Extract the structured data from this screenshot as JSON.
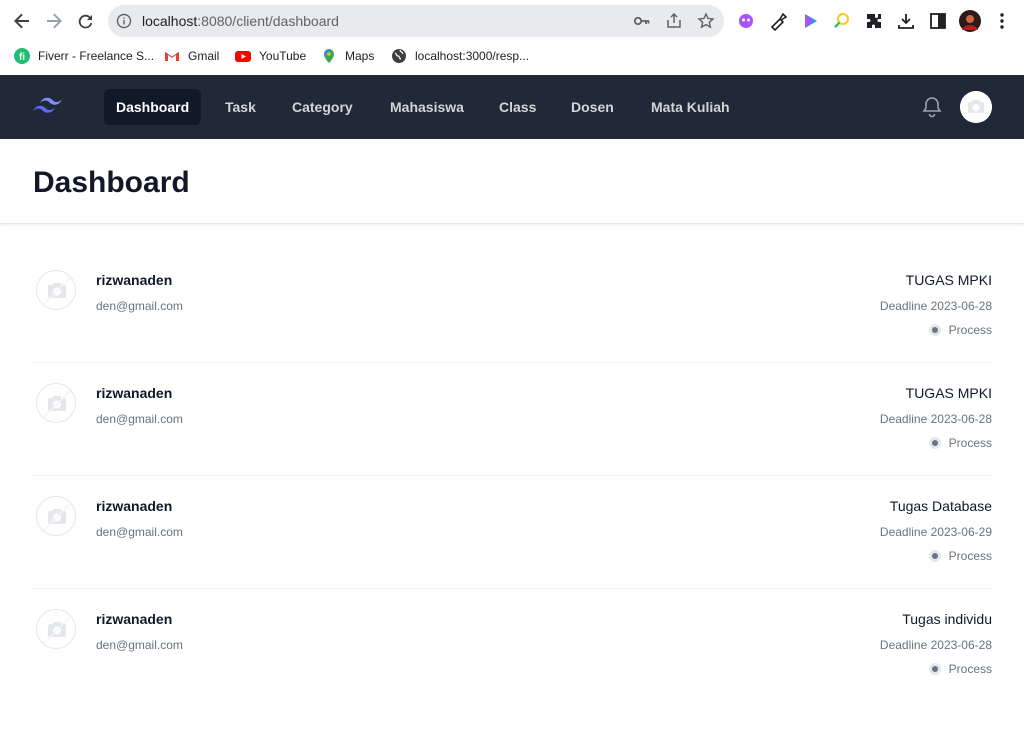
{
  "browser": {
    "url_host": "localhost",
    "url_path": ":8080/client/dashboard",
    "bookmarks": [
      {
        "label": "Fiverr - Freelance S...",
        "icon": "fiverr-icon"
      },
      {
        "label": "Gmail",
        "icon": "gmail-icon"
      },
      {
        "label": "YouTube",
        "icon": "youtube-icon"
      },
      {
        "label": "Maps",
        "icon": "maps-icon"
      },
      {
        "label": "localhost:3000/resp...",
        "icon": "globe-icon"
      }
    ]
  },
  "nav": {
    "items": [
      {
        "label": "Dashboard",
        "active": true
      },
      {
        "label": "Task"
      },
      {
        "label": "Category"
      },
      {
        "label": "Mahasiswa"
      },
      {
        "label": "Class"
      },
      {
        "label": "Dosen"
      },
      {
        "label": "Mata Kuliah"
      }
    ]
  },
  "header": {
    "title": "Dashboard"
  },
  "tasks": [
    {
      "name": "rizwanaden",
      "email": "den@gmail.com",
      "task": "TUGAS MPKI",
      "deadline": "Deadline 2023-06-28",
      "status": "Process"
    },
    {
      "name": "rizwanaden",
      "email": "den@gmail.com",
      "task": "TUGAS MPKI",
      "deadline": "Deadline 2023-06-28",
      "status": "Process"
    },
    {
      "name": "rizwanaden",
      "email": "den@gmail.com",
      "task": "Tugas Database",
      "deadline": "Deadline 2023-06-29",
      "status": "Process"
    },
    {
      "name": "rizwanaden",
      "email": "den@gmail.com",
      "task": "Tugas individu",
      "deadline": "Deadline 2023-06-28",
      "status": "Process"
    }
  ],
  "colors": {
    "nav_bg": "#1f2937",
    "nav_active": "#111827",
    "logo": "#6366f1"
  }
}
